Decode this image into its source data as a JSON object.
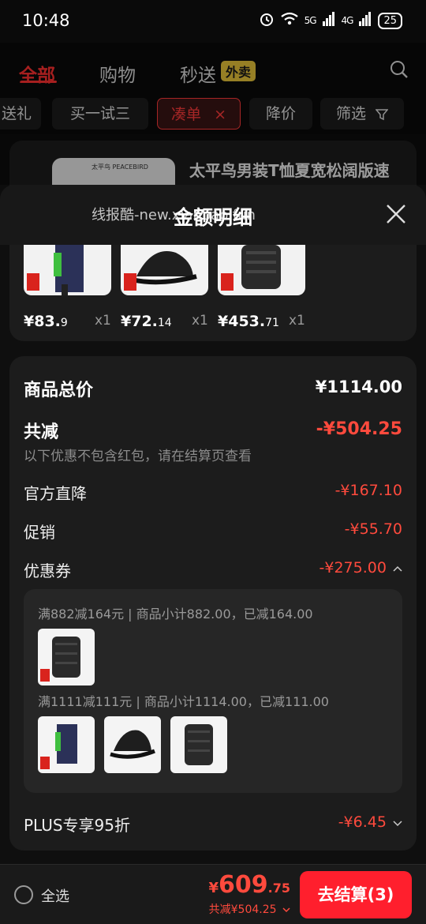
{
  "status": {
    "time": "10:48",
    "signal1": "5G",
    "signal2": "4G",
    "battery": "25"
  },
  "header": {
    "tabs": [
      "全部",
      "购物",
      "秒送"
    ],
    "waimai_badge": "外卖",
    "accent": "#ff3030"
  },
  "filters": {
    "chips": [
      "送礼",
      "买一试三",
      "凑单",
      "降价",
      "筛选"
    ],
    "active_close": "×"
  },
  "background_product": {
    "title": "太平鸟男装T恤夏宽松阔版速",
    "logo": "太平鸟 PEACEBIRD"
  },
  "sheet": {
    "title": "金额明细",
    "watermark": "线报酷-new.xianbao.fun",
    "products": [
      {
        "price_main": "¥83.",
        "price_dec": "9",
        "qty": "x1"
      },
      {
        "price_main": "¥72.",
        "price_dec": "14",
        "qty": "x1"
      },
      {
        "price_main": "¥453.",
        "price_dec": "71",
        "qty": "x1"
      }
    ],
    "details": {
      "total_label": "商品总价",
      "total_value": "¥1114.00",
      "reduce_label": "共减",
      "reduce_value": "-¥504.25",
      "reduce_note": "以下优惠不包含红包，请在结算页查看",
      "official_label": "官方直降",
      "official_value": "-¥167.10",
      "promo_label": "促销",
      "promo_value": "-¥55.70",
      "coupon_label": "优惠券",
      "coupon_value": "-¥275.00",
      "coupon_lines": [
        "满882减164元 | 商品小计882.00，已减164.00",
        "满1111减111元 | 商品小计1114.00，已减111.00"
      ],
      "plus_label": "PLUS专享95折",
      "plus_value": "-¥6.45"
    }
  },
  "bottom": {
    "select_all": "全选",
    "currency": "¥",
    "total_int": "609",
    "total_dec": ".75",
    "saved": "共减¥504.25",
    "checkout": "去结算(3)"
  }
}
